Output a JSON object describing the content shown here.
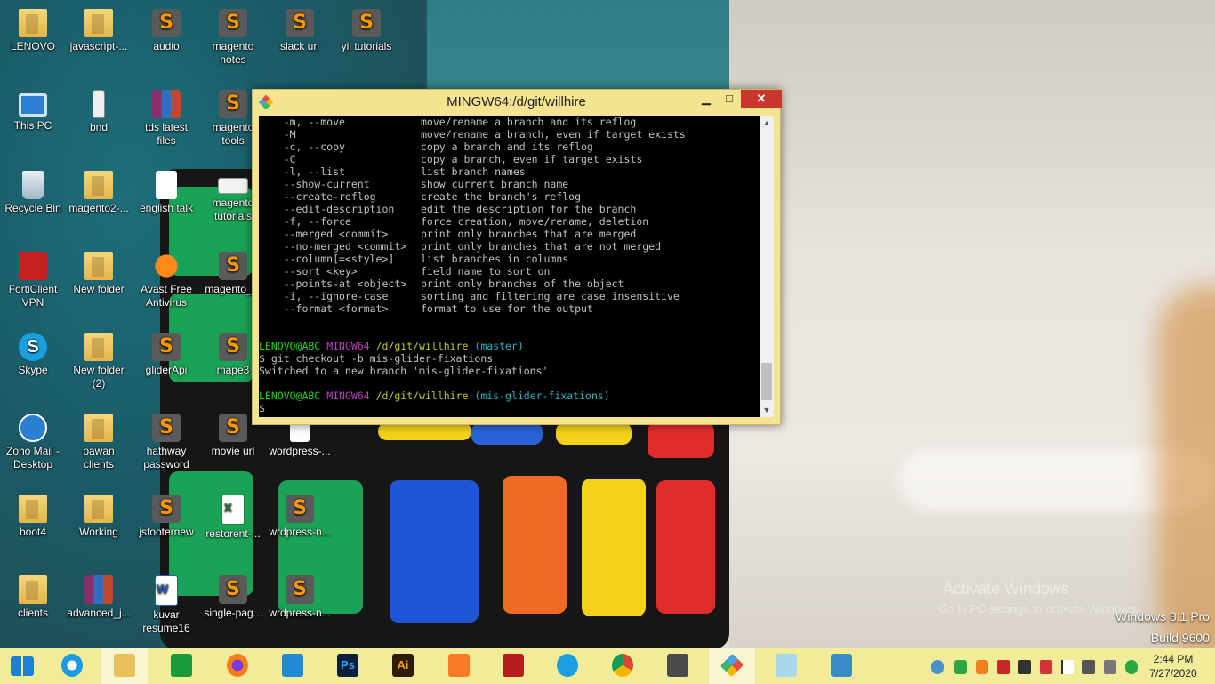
{
  "desktop": {
    "icons": [
      {
        "label": "LENOVO",
        "icon": "user-folder-icon"
      },
      {
        "label": "javascript-...",
        "icon": "folder-icon"
      },
      {
        "label": "audio",
        "icon": "sublime-file-icon"
      },
      {
        "label": "magento notes",
        "icon": "sublime-file-icon"
      },
      {
        "label": "slack url",
        "icon": "sublime-file-icon"
      },
      {
        "label": "yii tutorials",
        "icon": "sublime-file-icon"
      },
      {
        "label": "This PC",
        "icon": "computer-icon"
      },
      {
        "label": "bnd",
        "icon": "file-icon"
      },
      {
        "label": "tds latest files",
        "icon": "winrar-icon"
      },
      {
        "label": "magento tools",
        "icon": "sublime-file-icon"
      },
      {
        "label": "Recycle Bin",
        "icon": "recycle-bin-icon"
      },
      {
        "label": "magento2-...",
        "icon": "folder-icon"
      },
      {
        "label": "english talk",
        "icon": "document-icon"
      },
      {
        "label": "magento tutorials",
        "icon": "image-icon"
      },
      {
        "label": "FortiClient VPN",
        "icon": "forticlient-icon"
      },
      {
        "label": "New folder",
        "icon": "folder-icon"
      },
      {
        "label": "Avast Free Antivirus",
        "icon": "avast-icon"
      },
      {
        "label": "magento_...",
        "icon": "sublime-file-icon"
      },
      {
        "label": "Skype",
        "icon": "skype-icon"
      },
      {
        "label": "New folder (2)",
        "icon": "folder-icon"
      },
      {
        "label": "gliderApi",
        "icon": "sublime-file-icon"
      },
      {
        "label": "mape3",
        "icon": "sublime-file-icon"
      },
      {
        "label": "Zoho Mail - Desktop",
        "icon": "zoho-mail-icon"
      },
      {
        "label": "pawan clients",
        "icon": "folder-icon"
      },
      {
        "label": "hathway password",
        "icon": "sublime-file-icon"
      },
      {
        "label": "movie url",
        "icon": "sublime-file-icon"
      },
      {
        "label": "wordpress-...",
        "icon": "blank-file-icon"
      },
      {
        "label": "boot4",
        "icon": "folder-icon"
      },
      {
        "label": "Working",
        "icon": "folder-icon"
      },
      {
        "label": "jsfooternew",
        "icon": "sublime-file-icon"
      },
      {
        "label": "restorent-...",
        "icon": "excel-icon"
      },
      {
        "label": "wrdpress-n...",
        "icon": "sublime-file-icon"
      },
      {
        "label": "clients",
        "icon": "folder-icon"
      },
      {
        "label": "advanced_j...",
        "icon": "winrar-icon"
      },
      {
        "label": "kuvar resume16",
        "icon": "word-icon"
      },
      {
        "label": "single-pag...",
        "icon": "sublime-file-icon"
      },
      {
        "label": "wrdpress-n...",
        "icon": "sublime-file-icon"
      }
    ],
    "watermark_line1": "Activate Windows",
    "watermark_line2": "Go to PC settings to activate Windows.",
    "os_name": "Windows 8.1 Pro",
    "os_build": "Build 9600"
  },
  "terminal": {
    "title": "MINGW64:/d/git/willhire",
    "minimize_label": "▁",
    "maximize_label": "□",
    "close_label": "✕",
    "options": [
      {
        "flag": "    -m, --move",
        "desc": "move/rename a branch and its reflog"
      },
      {
        "flag": "    -M",
        "desc": "move/rename a branch, even if target exists"
      },
      {
        "flag": "    -c, --copy",
        "desc": "copy a branch and its reflog"
      },
      {
        "flag": "    -C",
        "desc": "copy a branch, even if target exists"
      },
      {
        "flag": "    -l, --list",
        "desc": "list branch names"
      },
      {
        "flag": "    --show-current",
        "desc": "show current branch name"
      },
      {
        "flag": "    --create-reflog",
        "desc": "create the branch's reflog"
      },
      {
        "flag": "    --edit-description",
        "desc": "edit the description for the branch"
      },
      {
        "flag": "    -f, --force",
        "desc": "force creation, move/rename, deletion"
      },
      {
        "flag": "    --merged <commit>",
        "desc": "print only branches that are merged"
      },
      {
        "flag": "    --no-merged <commit>",
        "desc": "print only branches that are not merged"
      },
      {
        "flag": "    --column[=<style>]",
        "desc": "list branches in columns"
      },
      {
        "flag": "    --sort <key>",
        "desc": "field name to sort on"
      },
      {
        "flag": "    --points-at <object>",
        "desc": "print only branches of the object"
      },
      {
        "flag": "    -i, --ignore-case",
        "desc": "sorting and filtering are case insensitive"
      },
      {
        "flag": "    --format <format>",
        "desc": "format to use for the output"
      }
    ],
    "prompt1": {
      "user": "LENOVO@ABC",
      "env": "MINGW64",
      "path": "/d/git/willhire",
      "branch": "(master)"
    },
    "command": "$ git checkout -b mis-glider-fixations",
    "output": "Switched to a new branch 'mis-glider-fixations'",
    "prompt2": {
      "user": "LENOVO@ABC",
      "env": "MINGW64",
      "path": "/d/git/willhire",
      "branch": "(mis-glider-fixations)"
    },
    "cursor": "$"
  },
  "taskbar": {
    "items": [
      {
        "name": "start-button",
        "icon": "windows-logo-icon",
        "active": false
      },
      {
        "name": "internet-explorer",
        "icon": "internet-explorer-icon",
        "active": false
      },
      {
        "name": "file-explorer",
        "icon": "file-explorer-icon",
        "active": true
      },
      {
        "name": "store",
        "icon": "store-icon",
        "active": false
      },
      {
        "name": "firefox",
        "icon": "firefox-icon",
        "active": false
      },
      {
        "name": "vscode",
        "icon": "vscode-icon",
        "active": false
      },
      {
        "name": "photoshop",
        "icon": "photoshop-icon",
        "label": "Ps",
        "active": false
      },
      {
        "name": "illustrator",
        "icon": "illustrator-icon",
        "label": "Ai",
        "active": false
      },
      {
        "name": "xampp",
        "icon": "xampp-icon",
        "active": false
      },
      {
        "name": "filezilla",
        "icon": "filezilla-icon",
        "active": false
      },
      {
        "name": "skype",
        "icon": "skype-icon",
        "active": false
      },
      {
        "name": "chrome",
        "icon": "chrome-icon",
        "active": false
      },
      {
        "name": "sublime-text",
        "icon": "sublime-icon",
        "active": false
      },
      {
        "name": "git-bash",
        "icon": "git-icon",
        "active": true
      },
      {
        "name": "notepad",
        "icon": "notepad-icon",
        "active": false
      },
      {
        "name": "photos",
        "icon": "photos-icon",
        "active": false
      }
    ],
    "time": "2:44 PM",
    "date": "7/27/2020",
    "colors": {
      "taskbar": "#f0ec9a",
      "window_frame": "#f4e38f",
      "close": "#c7372e"
    }
  }
}
